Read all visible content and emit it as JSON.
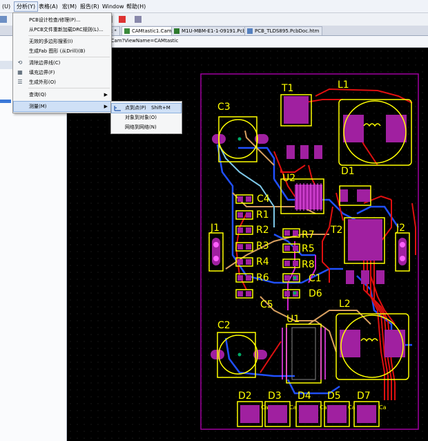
{
  "menubar": {
    "items": [
      {
        "label": "(U)"
      },
      {
        "label": "分析(Y)"
      },
      {
        "label": "表格(A)"
      },
      {
        "label": "宏(M)"
      },
      {
        "label": "报告(R)"
      },
      {
        "label": "Window"
      },
      {
        "label": "帮助(H)"
      }
    ]
  },
  "tabs": [
    {
      "label": "oc *"
    },
    {
      "label": "CAMtastic1.Cam *"
    },
    {
      "label": "M1U-MBM-E1-1-09191.PcbDoc"
    },
    {
      "label": "PCB_TLDS895.PcbDoc.htm"
    }
  ],
  "address": "c1.Cam?ViewName=CAMtastic",
  "menu": {
    "items": [
      {
        "label": "PCB设计检查/修理(P)..."
      },
      {
        "label": "从PCB文件重新加载DRC规则(L)..."
      },
      {
        "label": "无效的多边形搜索(I)"
      },
      {
        "label": "生成Fab 图形 (从Drill)(B)"
      },
      {
        "label": "清除边界线(C)",
        "icon": "clear-border-icon"
      },
      {
        "label": "填充边界(F)",
        "icon": "fill-border-icon"
      },
      {
        "label": "生成外形(O)",
        "icon": "outline-icon"
      },
      {
        "label": "查询(Q)"
      },
      {
        "label": "测量(M)"
      }
    ]
  },
  "submenu": {
    "items": [
      {
        "label": "点到点(P)",
        "shortcut": "Shift+M"
      },
      {
        "label": "对象到对象(O)"
      },
      {
        "label": "网络到网络(N)"
      }
    ]
  },
  "pcb": {
    "components": [
      "T1",
      "L1",
      "C3",
      "U2",
      "D1",
      "C4",
      "R1",
      "J1",
      "R2",
      "T2",
      "J2",
      "R7",
      "R3",
      "R5",
      "R4",
      "R8",
      "R6",
      "C1",
      "D6",
      "C5",
      "L2",
      "C2",
      "U1",
      "D2",
      "D3",
      "D4",
      "D5",
      "D7"
    ],
    "pad_labels": [
      "Ca",
      "Ca",
      "Ca",
      "Ca",
      "Ca"
    ],
    "colors": {
      "board_outline": "#a000a0",
      "copper_top": "#e01010",
      "copper_bottom": "#2050ff",
      "pad": "#a020a0",
      "silk": "#ffff00",
      "trace_alt": "#d8a060"
    }
  }
}
